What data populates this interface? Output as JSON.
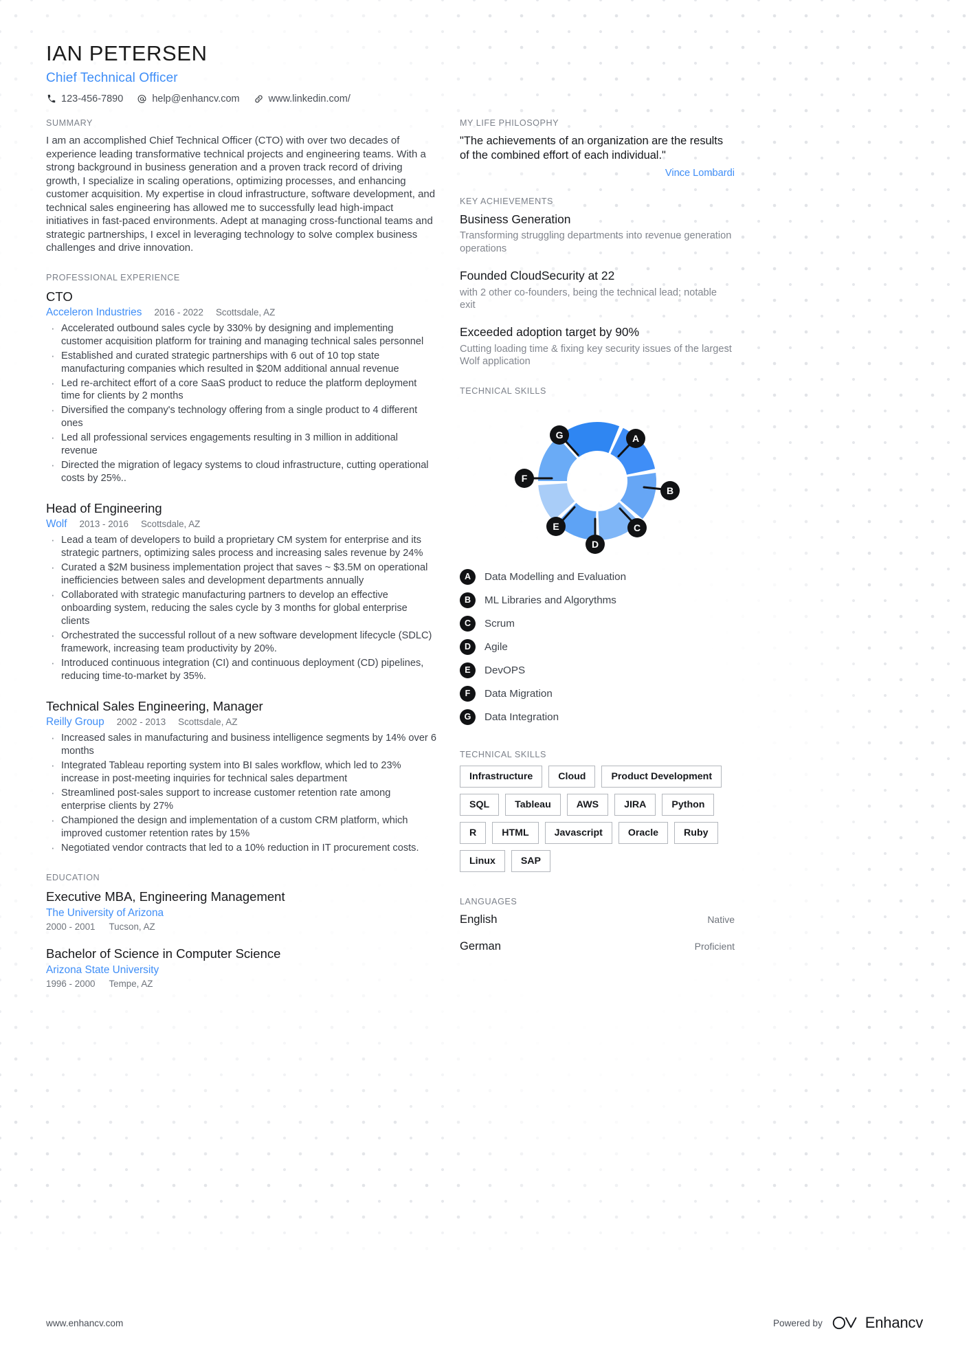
{
  "header": {
    "name": "IAN PETERSEN",
    "role": "Chief Technical Officer",
    "contacts": [
      {
        "icon": "phone-icon",
        "text": "123-456-7890"
      },
      {
        "icon": "at-icon",
        "text": "help@enhancv.com"
      },
      {
        "icon": "link-icon",
        "text": "www.linkedin.com/"
      }
    ]
  },
  "summary": {
    "title": "SUMMARY",
    "text": "I am an accomplished Chief Technical Officer (CTO) with over two decades of experience leading transformative technical projects and engineering teams. With a strong background in business generation and a proven track record of driving growth, I specialize in scaling operations, optimizing processes, and enhancing customer acquisition. My expertise in cloud infrastructure, software development, and technical sales engineering has allowed me to successfully lead high-impact initiatives in fast-paced environments. Adept at managing cross-functional teams and strategic partnerships, I excel in leveraging technology to solve complex business challenges and drive innovation."
  },
  "experience": {
    "title": "PROFESSIONAL EXPERIENCE",
    "jobs": [
      {
        "title": "CTO",
        "company": "Acceleron Industries",
        "dates": "2016 - 2022",
        "location": "Scottsdale, AZ",
        "bullets": [
          "Accelerated outbound sales cycle by 330% by designing and implementing customer acquisition platform for training and managing technical sales personnel",
          "Established and curated strategic partnerships with 6 out of 10 top state manufacturing companies which resulted in $20M additional annual revenue",
          "Led re-architect effort of a core SaaS product to reduce the platform deployment time for clients by 2 months",
          "Diversified the company's technology offering from a single product to 4 different ones",
          "Led all professional services engagements resulting in 3 million in additional revenue",
          "Directed the migration of legacy systems to cloud infrastructure, cutting operational costs by 25%.."
        ]
      },
      {
        "title": "Head of Engineering",
        "company": "Wolf",
        "dates": "2013 - 2016",
        "location": "Scottsdale, AZ",
        "bullets": [
          "Lead a team of developers to build a proprietary CM system for enterprise and its strategic partners, optimizing sales process and increasing sales revenue by 24%",
          "Curated a $2M business implementation project that saves ~ $3.5M on operational inefficiencies between sales and development departments annually",
          "Collaborated with strategic manufacturing partners to develop an effective onboarding system, reducing the sales cycle by 3 months for global enterprise clients",
          "Orchestrated the successful rollout of a new software development lifecycle (SDLC) framework, increasing team productivity by 20%.",
          "Introduced continuous integration (CI) and continuous deployment (CD) pipelines, reducing time-to-market by 35%."
        ]
      },
      {
        "title": "Technical Sales Engineering, Manager",
        "company": "Reilly Group",
        "dates": "2002 - 2013",
        "location": "Scottsdale, AZ",
        "bullets": [
          "Increased sales in manufacturing and business intelligence segments by 14% over 6 months",
          "Integrated Tableau reporting system into BI sales workflow, which led to 23% increase in post-meeting inquiries for technical sales department",
          "Streamlined post-sales support to increase customer retention rate among enterprise clients by 27%",
          "Championed the design and implementation of a custom CRM platform, which improved customer retention rates by 15%",
          "Negotiated vendor contracts that led to a 10% reduction in IT procurement costs."
        ]
      }
    ]
  },
  "education": {
    "title": "EDUCATION",
    "entries": [
      {
        "degree": "Executive MBA, Engineering Management",
        "school": "The University of Arizona",
        "dates": "2000 - 2001",
        "location": "Tucson, AZ"
      },
      {
        "degree": "Bachelor of Science in Computer Science",
        "school": "Arizona State University",
        "dates": "1996 - 2000",
        "location": "Tempe, AZ"
      }
    ]
  },
  "philosophy": {
    "title": "MY LIFE PHILOSOPHY",
    "quote": "\"The achievements of an organization are the results of the combined effort of each individual.\"",
    "author": "Vince Lombardi"
  },
  "achievements": {
    "title": "KEY ACHIEVEMENTS",
    "items": [
      {
        "title": "Business Generation",
        "desc": "Transforming struggling departments into revenue generation operations"
      },
      {
        "title": "Founded CloudSecurity at 22",
        "desc": "with 2 other co-founders, being the technical lead; notable exit"
      },
      {
        "title": "Exceeded adoption target by 90%",
        "desc": "Cutting loading time & fixing key security issues of the largest Wolf application"
      }
    ]
  },
  "skills_chart": {
    "title": "TECHNICAL SKILLS",
    "legend": [
      {
        "key": "A",
        "label": "Data Modelling and Evaluation"
      },
      {
        "key": "B",
        "label": "ML Libraries and Algorythms"
      },
      {
        "key": "C",
        "label": "Scrum"
      },
      {
        "key": "D",
        "label": "Agile"
      },
      {
        "key": "E",
        "label": "DevOPS"
      },
      {
        "key": "F",
        "label": "Data Migration"
      },
      {
        "key": "G",
        "label": "Data Integration"
      }
    ]
  },
  "chart_data": {
    "type": "pie",
    "title": "TECHNICAL SKILLS",
    "subtype": "donut",
    "legend_position": "below",
    "categories": [
      "A",
      "B",
      "C",
      "D",
      "E",
      "F",
      "G"
    ],
    "labels": [
      "Data Modelling and Evaluation",
      "ML Libraries and Algorythms",
      "Scrum",
      "Agile",
      "DevOPS",
      "Data Migration",
      "Data Integration"
    ],
    "values": [
      14.3,
      14.3,
      14.3,
      14.3,
      14.3,
      14.3,
      14.3
    ],
    "colors": [
      "#3f8ef7",
      "#66a6f5",
      "#7fb6f7",
      "#5ea3f5",
      "#a9cdf8",
      "#6aabf6",
      "#2f86f2"
    ]
  },
  "skills_tags": {
    "title": "TECHNICAL SKILLS",
    "tags": [
      "Infrastructure",
      "Cloud",
      "Product Development",
      "SQL",
      "Tableau",
      "AWS",
      "JIRA",
      "Python",
      "R",
      "HTML",
      "Javascript",
      "Oracle",
      "Ruby",
      "Linux",
      "SAP"
    ]
  },
  "languages": {
    "title": "LANGUAGES",
    "items": [
      {
        "name": "English",
        "level": "Native"
      },
      {
        "name": "German",
        "level": "Proficient"
      }
    ]
  },
  "footer": {
    "url": "www.enhancv.com",
    "powered_by": "Powered by",
    "brand": "Enhancv"
  },
  "colors": {
    "accent": "#3f8ef7",
    "text": "#3e434b",
    "muted": "#7c818a"
  }
}
